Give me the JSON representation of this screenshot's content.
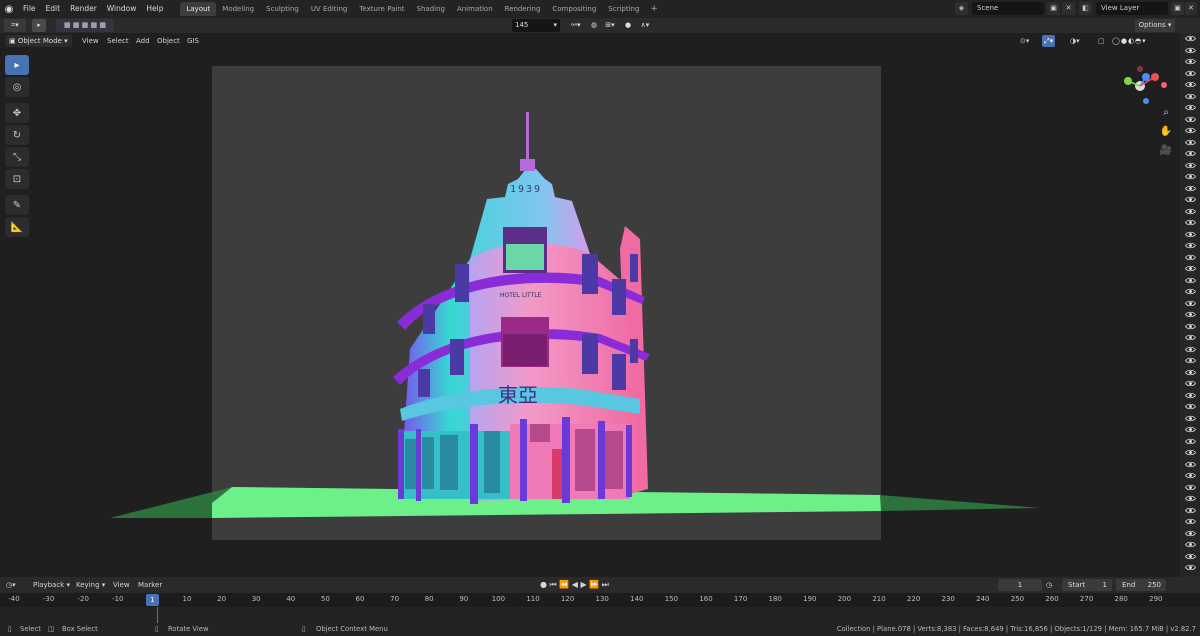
{
  "menu": {
    "items": [
      "File",
      "Edit",
      "Render",
      "Window",
      "Help"
    ]
  },
  "workspaces": [
    {
      "label": "Layout",
      "active": true
    },
    {
      "label": "Modeling",
      "active": false
    },
    {
      "label": "Sculpting",
      "active": false
    },
    {
      "label": "UV Editing",
      "active": false
    },
    {
      "label": "Texture Paint",
      "active": false
    },
    {
      "label": "Shading",
      "active": false
    },
    {
      "label": "Animation",
      "active": false
    },
    {
      "label": "Rendering",
      "active": false
    },
    {
      "label": "Compositing",
      "active": false
    },
    {
      "label": "Scripting",
      "active": false
    }
  ],
  "scene": {
    "name": "Scene",
    "view_layer": "View Layer"
  },
  "header2": {
    "frame_value": "145",
    "options_label": "Options"
  },
  "viewport_header": {
    "mode": "Object Mode",
    "menus": [
      "View",
      "Select",
      "Add",
      "Object",
      "GIS"
    ]
  },
  "building": {
    "year_label": "1939",
    "sign_text": "東亞",
    "small_sign": "HOTEL LITTLE"
  },
  "timeline": {
    "menus": [
      "Playback",
      "Keying",
      "View",
      "Marker"
    ],
    "current_frame": "1",
    "start_label": "Start",
    "start_value": "1",
    "end_label": "End",
    "end_value": "250",
    "ticks": [
      "-40",
      "-30",
      "-20",
      "-10",
      "1",
      "10",
      "20",
      "30",
      "40",
      "50",
      "60",
      "70",
      "80",
      "90",
      "100",
      "110",
      "120",
      "130",
      "140",
      "150",
      "160",
      "170",
      "180",
      "190",
      "200",
      "210",
      "220",
      "230",
      "240",
      "250",
      "260",
      "270",
      "280",
      "290"
    ]
  },
  "status": {
    "select": "Select",
    "box_select": "Box Select",
    "rotate_view": "Rotate View",
    "context_menu": "Object Context Menu",
    "stats": "Collection | Plane.078 | Verts:8,383 | Faces:8,649 | Tris:16,856 | Objects:1/129 | Mem: 165.7 MiB | v2.82.7"
  },
  "colors": {
    "accent": "#4772b3",
    "ground": "#6cf08a",
    "building_cyan": "#35d7d0",
    "building_pink": "#f17fb6",
    "building_purple": "#8a2bd8"
  }
}
